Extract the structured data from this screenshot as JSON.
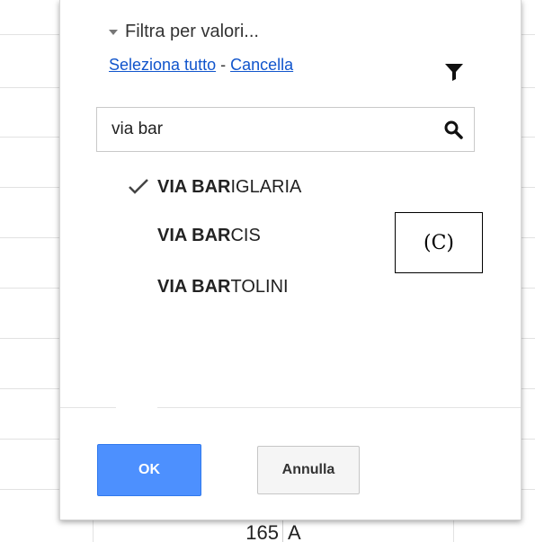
{
  "filter": {
    "header_label": "Filtra per valori...",
    "select_all_label": "Seleziona tutto",
    "separator": "-",
    "clear_label": "Cancella"
  },
  "search": {
    "value": "via bar"
  },
  "values": [
    {
      "match": "VIA BAR",
      "rest": "IGLARIA",
      "checked": true
    },
    {
      "match": "VIA BAR",
      "rest": "CIS",
      "checked": false
    },
    {
      "match": "VIA BAR",
      "rest": "TOLINI",
      "checked": false
    }
  ],
  "annotation": {
    "label": "(C)"
  },
  "buttons": {
    "ok_label": "OK",
    "cancel_label": "Annulla"
  },
  "sheet": {
    "bottom_cell_number": "165",
    "bottom_cell_letter": "A"
  },
  "colors": {
    "ok_blue": "#4d90fe",
    "link_blue": "#1155cc"
  },
  "icons": {
    "filter": "funnel-icon",
    "search": "magnifier-icon",
    "checkmark": "check-icon",
    "expand": "triangle-down-icon"
  }
}
